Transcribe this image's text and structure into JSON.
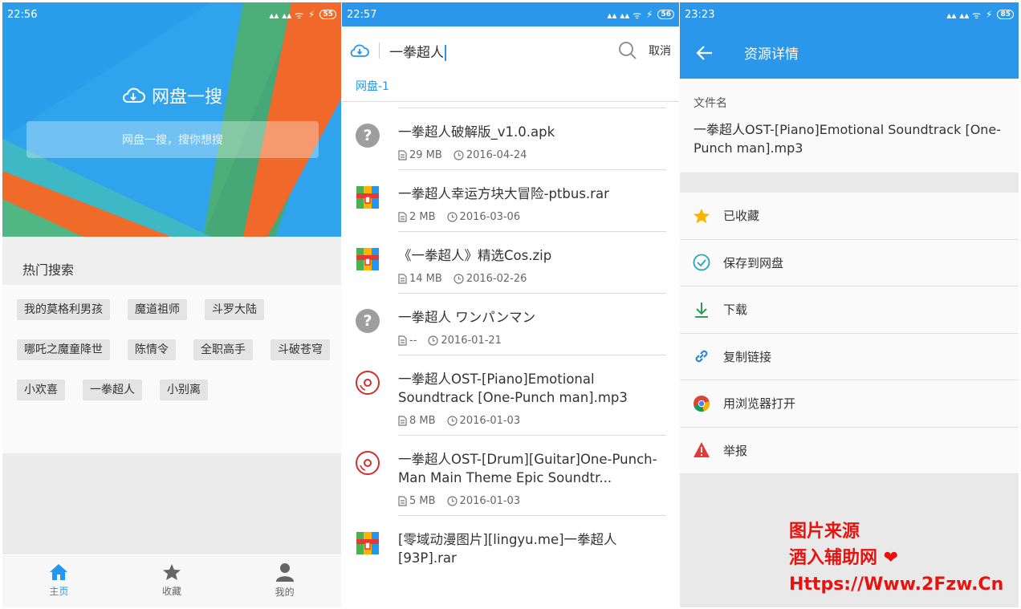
{
  "panel1": {
    "status": {
      "time": "22:56",
      "battery": "55"
    },
    "brand": "网盘一搜",
    "search_placeholder": "网盘一搜，搜你想搜",
    "hot_title": "热门搜索",
    "hot_tags": [
      "我的莫格利男孩",
      "魔道祖师",
      "斗罗大陆",
      "哪吒之魔童降世",
      "陈情令",
      "全职高手",
      "斗破苍穹",
      "小欢喜",
      "一拳超人",
      "小别离"
    ],
    "nav": [
      {
        "label": "主页",
        "icon": "home-icon",
        "active": true
      },
      {
        "label": "收藏",
        "icon": "star-icon",
        "active": false
      },
      {
        "label": "我的",
        "icon": "person-icon",
        "active": false
      }
    ]
  },
  "panel2": {
    "status": {
      "time": "22:57",
      "battery": "56"
    },
    "query": "一拳超人",
    "cancel": "取消",
    "tab": "网盘-1",
    "results": [
      {
        "title": "一拳超人破解版_v1.0.apk",
        "size": "29 MB",
        "date": "2016-04-24",
        "icon": "unknown-file-icon"
      },
      {
        "title": "一拳超人幸运方块大冒险-ptbus.rar",
        "size": "2 MB",
        "date": "2016-03-06",
        "icon": "archive-icon"
      },
      {
        "title": "《一拳超人》精选Cos.zip",
        "size": "14 MB",
        "date": "2016-02-26",
        "icon": "archive-icon"
      },
      {
        "title": "一拳超人 ワンパンマン",
        "size": "--",
        "date": "2016-01-21",
        "icon": "unknown-file-icon"
      },
      {
        "title": "一拳超人OST-[Piano]Emotional Soundtrack [One-Punch man].mp3",
        "size": "8 MB",
        "date": "2016-01-03",
        "icon": "music-disc-icon"
      },
      {
        "title": "一拳超人OST-[Drum][Guitar]One-Punch-Man Main Theme Epic Soundtr...",
        "size": "5 MB",
        "date": "2016-01-03",
        "icon": "music-disc-icon"
      },
      {
        "title": "[零域动漫图片][lingyu.me]一拳超人[93P].rar",
        "size": "",
        "date": "",
        "icon": "archive-icon"
      }
    ]
  },
  "panel3": {
    "status": {
      "time": "23:23",
      "battery": "85"
    },
    "title": "资源详情",
    "file_label": "文件名",
    "file_name": "一拳超人OST-[Piano]Emotional Soundtrack [One-Punch man].mp3",
    "actions": [
      {
        "label": "已收藏",
        "icon": "star-icon"
      },
      {
        "label": "保存到网盘",
        "icon": "check-circle-icon"
      },
      {
        "label": "下载",
        "icon": "download-icon"
      },
      {
        "label": "复制链接",
        "icon": "link-icon"
      },
      {
        "label": "用浏览器打开",
        "icon": "chrome-icon"
      },
      {
        "label": "举报",
        "icon": "warning-icon"
      }
    ],
    "watermark": [
      "图片来源",
      "酒入辅助网 ❤",
      "Https://Www.2Fzw.Cn"
    ]
  },
  "colors": {
    "primary": "#2a97ea",
    "accent": "#2196f3",
    "watermark": "#e8130f"
  }
}
